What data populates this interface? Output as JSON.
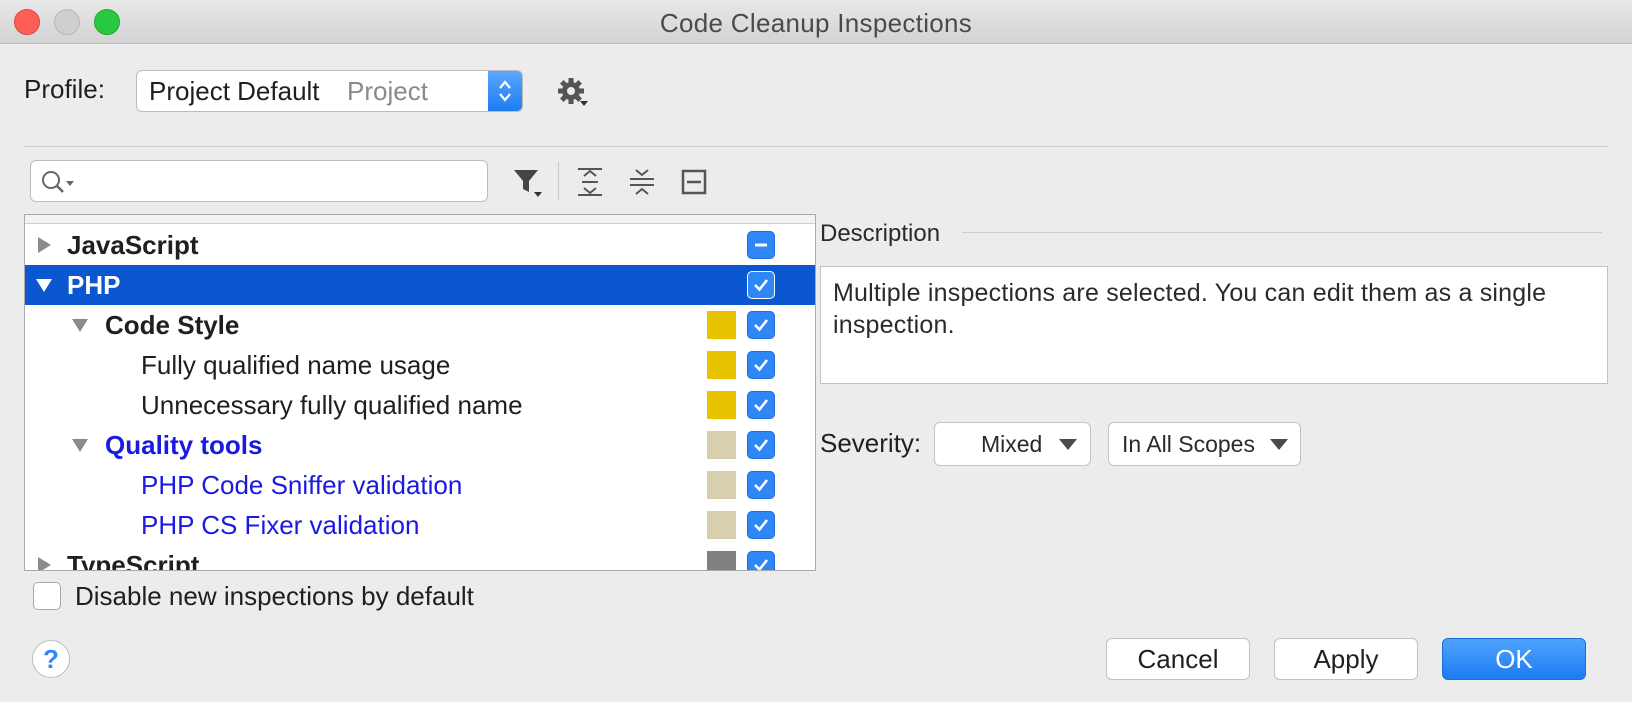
{
  "window": {
    "title": "Code Cleanup Inspections"
  },
  "profile": {
    "label": "Profile:",
    "name": "Project Default",
    "scope": "Project"
  },
  "search": {
    "placeholder": ""
  },
  "tree": {
    "rows": [
      {
        "label": "JavaScript",
        "level": 0,
        "expanded": false,
        "bold": true,
        "blue": false,
        "selected": false,
        "swatch": null,
        "checkbox": "indeterminate"
      },
      {
        "label": "PHP",
        "level": 0,
        "expanded": true,
        "bold": true,
        "blue": false,
        "selected": true,
        "swatch": null,
        "checkbox": "checked"
      },
      {
        "label": "Code Style",
        "level": 1,
        "expanded": true,
        "bold": true,
        "blue": false,
        "selected": false,
        "swatch": "#e8c400",
        "checkbox": "checked"
      },
      {
        "label": "Fully qualified name usage",
        "level": 2,
        "bold": false,
        "blue": false,
        "selected": false,
        "swatch": "#e8c400",
        "checkbox": "checked"
      },
      {
        "label": "Unnecessary fully qualified name",
        "level": 2,
        "bold": false,
        "blue": false,
        "selected": false,
        "swatch": "#e8c400",
        "checkbox": "checked"
      },
      {
        "label": "Quality tools",
        "level": 1,
        "expanded": true,
        "bold": true,
        "blue": true,
        "selected": false,
        "swatch": "#d8cfae",
        "checkbox": "checked"
      },
      {
        "label": "PHP Code Sniffer validation",
        "level": 2,
        "bold": false,
        "blue": true,
        "selected": false,
        "swatch": "#d8cfae",
        "checkbox": "checked"
      },
      {
        "label": "PHP CS Fixer validation",
        "level": 2,
        "bold": false,
        "blue": true,
        "selected": false,
        "swatch": "#d8cfae",
        "checkbox": "checked"
      },
      {
        "label": "TypeScript",
        "level": 0,
        "expanded": false,
        "bold": true,
        "blue": false,
        "selected": false,
        "swatch": "#808080",
        "checkbox": "checked"
      }
    ]
  },
  "description": {
    "label": "Description",
    "text": "Multiple inspections are selected. You can edit them as a single inspection."
  },
  "severity": {
    "label": "Severity:",
    "value": "Mixed",
    "scope": "In All Scopes"
  },
  "options": {
    "disable_new_label": "Disable new inspections by default",
    "disable_new_checked": false
  },
  "buttons": {
    "help": "?",
    "cancel": "Cancel",
    "apply": "Apply",
    "ok": "OK"
  },
  "colors": {
    "accent": "#2f86f6",
    "selection": "#0b57d0",
    "link_blue": "#1a1ae0"
  }
}
